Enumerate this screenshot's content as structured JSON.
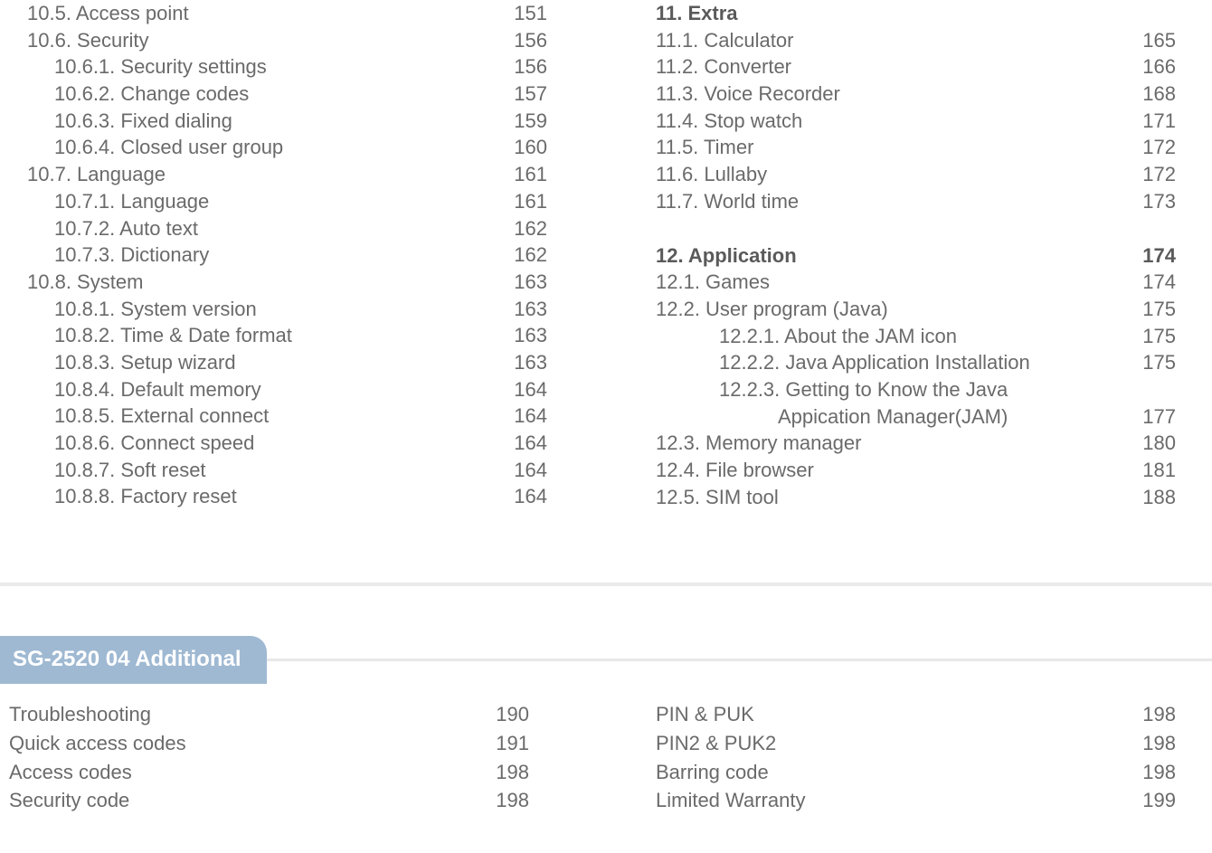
{
  "left_column": [
    {
      "label": "10.5. Access point",
      "page": "151",
      "indent": "indent1"
    },
    {
      "label": "10.6. Security",
      "page": "156",
      "indent": "indent1"
    },
    {
      "label": "10.6.1. Security settings",
      "page": "156",
      "indent": "indent2"
    },
    {
      "label": "10.6.2. Change codes",
      "page": "157",
      "indent": "indent2"
    },
    {
      "label": "10.6.3. Fixed dialing",
      "page": "159",
      "indent": "indent2"
    },
    {
      "label": "10.6.4. Closed user group",
      "page": "160",
      "indent": "indent2"
    },
    {
      "label": "10.7. Language",
      "page": "161",
      "indent": "indent1"
    },
    {
      "label": "10.7.1. Language",
      "page": "161",
      "indent": "indent2"
    },
    {
      "label": "10.7.2. Auto text",
      "page": "162",
      "indent": "indent2"
    },
    {
      "label": "10.7.3. Dictionary",
      "page": "162",
      "indent": "indent2"
    },
    {
      "label": "10.8. System",
      "page": "163",
      "indent": "indent1"
    },
    {
      "label": "10.8.1. System version",
      "page": "163",
      "indent": "indent2"
    },
    {
      "label": "10.8.2. Time & Date format",
      "page": "163",
      "indent": "indent2"
    },
    {
      "label": "10.8.3. Setup wizard",
      "page": "163",
      "indent": "indent2"
    },
    {
      "label": "10.8.4. Default memory",
      "page": "164",
      "indent": "indent2"
    },
    {
      "label": "10.8.5. External connect",
      "page": "164",
      "indent": "indent2"
    },
    {
      "label": "10.8.6. Connect speed",
      "page": "164",
      "indent": "indent2"
    },
    {
      "label": "10.8.7. Soft reset",
      "page": "164",
      "indent": "indent2"
    },
    {
      "label": "10.8.8. Factory reset",
      "page": "164",
      "indent": "indent2"
    }
  ],
  "right_column_groups": [
    {
      "heading": {
        "label": "11. Extra",
        "page": ""
      },
      "items": [
        {
          "label": "11.1. Calculator",
          "page": "165",
          "indent": "indent1"
        },
        {
          "label": "11.2. Converter",
          "page": "166",
          "indent": "indent1"
        },
        {
          "label": "11.3. Voice Recorder",
          "page": "168",
          "indent": "indent1"
        },
        {
          "label": "11.4. Stop watch",
          "page": "171",
          "indent": "indent1"
        },
        {
          "label": "11.5. Timer",
          "page": "172",
          "indent": "indent1"
        },
        {
          "label": "11.6. Lullaby",
          "page": "172",
          "indent": "indent1"
        },
        {
          "label": "11.7. World time",
          "page": "173",
          "indent": "indent1"
        }
      ]
    },
    {
      "heading": {
        "label": "12. Application",
        "page": "174"
      },
      "items": [
        {
          "label": "12.1. Games",
          "page": "174",
          "indent": "indent1"
        },
        {
          "label": "12.2. User program (Java)",
          "page": "175",
          "indent": "indent1"
        },
        {
          "label": "12.2.1. About the JAM icon",
          "page": "175",
          "indent": "indent3"
        },
        {
          "label": "12.2.2. Java Application Installation",
          "page": "175",
          "indent": "indent3"
        },
        {
          "label": "12.2.3. Getting to Know the Java",
          "page": "",
          "indent": "indent3"
        },
        {
          "label": "Appication Manager(JAM)",
          "page": "177",
          "indent": "cont-line"
        },
        {
          "label": "12.3. Memory manager",
          "page": "180",
          "indent": "indent1"
        },
        {
          "label": "12.4. File browser",
          "page": "181",
          "indent": "indent1"
        },
        {
          "label": "12.5. SIM tool",
          "page": "188",
          "indent": "indent1"
        }
      ]
    }
  ],
  "section_tab": "SG-2520 04 Additional",
  "bottom_left": [
    {
      "label": "Troubleshooting",
      "page": "190"
    },
    {
      "label": "Quick access codes",
      "page": "191"
    },
    {
      "label": "Access codes",
      "page": "198"
    },
    {
      "label": "Security code",
      "page": "198"
    }
  ],
  "bottom_right": [
    {
      "label": "PIN & PUK",
      "page": "198"
    },
    {
      "label": "PIN2 & PUK2",
      "page": "198"
    },
    {
      "label": "Barring code",
      "page": "198"
    },
    {
      "label": "Limited Warranty",
      "page": "199"
    }
  ]
}
